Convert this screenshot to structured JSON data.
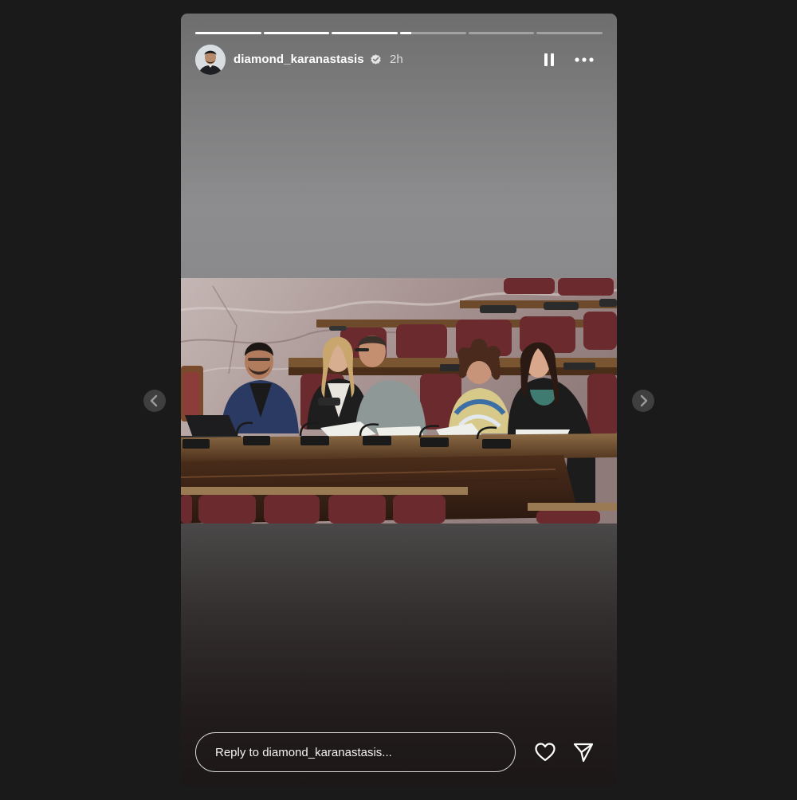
{
  "story": {
    "username": "diamond_karanastasis",
    "time_ago": "2h",
    "verified": true,
    "segments": [
      {
        "state": "viewed",
        "progress": 1.0
      },
      {
        "state": "viewed",
        "progress": 1.0
      },
      {
        "state": "viewed",
        "progress": 1.0
      },
      {
        "state": "current",
        "progress": 0.17
      },
      {
        "state": "upcoming",
        "progress": 0.0
      },
      {
        "state": "upcoming",
        "progress": 0.0
      }
    ],
    "media": {
      "type": "photo",
      "colors": {
        "seat": "#6b2a2e",
        "desk": "#5b3a22",
        "marble": "#b9a9a6"
      }
    }
  },
  "controls": {
    "pause_icon": "pause-icon",
    "more_icon": "more-horizontal-icon",
    "like_icon": "heart-outline-icon",
    "share_icon": "paper-plane-icon",
    "prev_icon": "chevron-left-icon",
    "next_icon": "chevron-right-icon"
  },
  "reply": {
    "placeholder": "Reply to diamond_karanastasis..."
  },
  "colors": {
    "page_background": "#1a1a1a",
    "text": "#ffffff",
    "nav_button": "#3f3f3f"
  }
}
